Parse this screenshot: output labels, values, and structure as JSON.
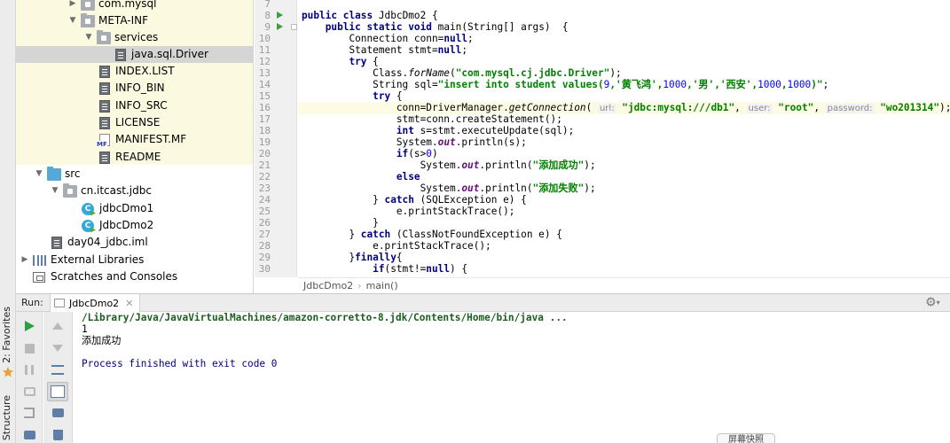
{
  "side_tabs": {
    "favorites": "2: Favorites",
    "structure": "Structure"
  },
  "project_tree": {
    "items": [
      {
        "label": "com.mysql"
      },
      {
        "label": "META-INF"
      },
      {
        "label": "services"
      },
      {
        "label": "java.sql.Driver"
      },
      {
        "label": "INDEX.LIST"
      },
      {
        "label": "INFO_BIN"
      },
      {
        "label": "INFO_SRC"
      },
      {
        "label": "LICENSE"
      },
      {
        "label": "MANIFEST.MF"
      },
      {
        "label": "README"
      },
      {
        "label": "src"
      },
      {
        "label": "cn.itcast.jdbc"
      },
      {
        "label": "jdbcDmo1"
      },
      {
        "label": "JdbcDmo2"
      },
      {
        "label": "day04_jdbc.iml"
      },
      {
        "label": "External Libraries"
      },
      {
        "label": "Scratches and Consoles"
      }
    ]
  },
  "editor": {
    "line_numbers": [
      "7",
      "8",
      "9",
      "10",
      "11",
      "12",
      "13",
      "14",
      "15",
      "16",
      "17",
      "18",
      "19",
      "20",
      "21",
      "22",
      "23",
      "24",
      "25",
      "26",
      "27",
      "28",
      "29",
      "30"
    ],
    "code": {
      "l8_kw1": "public",
      "l8_kw2": "class",
      "l8_rest": " JdbcDmo2 {",
      "l9_kw1": "public",
      "l9_kw2": "static",
      "l9_kw3": "void",
      "l9_rest": " main(String[] args)  {",
      "l10_a": "Connection conn=",
      "l10_kw": "null",
      "l10_b": ";",
      "l11_a": "Statement stmt=",
      "l11_kw": "null",
      "l11_b": ";",
      "l12_kw": "try",
      "l12_b": " {",
      "l13_a": "Class.",
      "l13_m": "forName",
      "l13_b": "(",
      "l13_s": "\"com.mysql.cj.jdbc.Driver\"",
      "l13_c": ");",
      "l14_a": "String sql=",
      "l14_s1": "\"insert into student values(",
      "l14_n1": "9",
      "l14_s2": ",'黄飞鸿',",
      "l14_n2": "1000",
      "l14_s3": ",'男','西安',",
      "l14_n3": "1000",
      "l14_s4": ",",
      "l14_n4": "1000",
      "l14_s5": ")\"",
      "l14_b": ";",
      "l15_kw": "try",
      "l15_b": " {",
      "l16_a": "conn=DriverManager.",
      "l16_m": "getConnection",
      "l16_b": "( ",
      "l16_h1": "url:",
      "l16_s1": "\"jdbc:mysql:///db1\"",
      "l16_c1": ", ",
      "l16_h2": "user:",
      "l16_s2": "\"root\"",
      "l16_c2": ", ",
      "l16_h3": "password:",
      "l16_s3": "\"wo201314\"",
      "l16_end": ");",
      "l17": "stmt=conn.createStatement();",
      "l18_kw": "int",
      "l18_rest": " s=stmt.executeUpdate(sql);",
      "l19_a": "System.",
      "l19_f": "out",
      "l19_b": ".println(s);",
      "l20_kw": "if",
      "l20_a": "(s>",
      "l20_n": "0",
      "l20_b": ")",
      "l21_a": "System.",
      "l21_f": "out",
      "l21_b": ".println(",
      "l21_s": "\"添加成功\"",
      "l21_c": ");",
      "l22_kw": "else",
      "l23_a": "System.",
      "l23_f": "out",
      "l23_b": ".println(",
      "l23_s": "\"添加失败\"",
      "l23_c": ");",
      "l24_a": "} ",
      "l24_kw": "catch",
      "l24_b": " (SQLException e) {",
      "l25": "e.printStackTrace();",
      "l26": "}",
      "l27_a": "} ",
      "l27_kw": "catch",
      "l27_b": " (ClassNotFoundException e) {",
      "l28": "e.printStackTrace();",
      "l29_a": "}",
      "l29_kw": "finally",
      "l29_b": "{",
      "l30_kw": "if",
      "l30_a": "(stmt!=",
      "l30_kw2": "null",
      "l30_b": ") {"
    },
    "breadcrumb": [
      "JdbcDmo2",
      "main()"
    ]
  },
  "run_panel": {
    "label": "Run:",
    "tab_title": "JdbcDmo2",
    "console_lines": {
      "cmd": "/Library/Java/JavaVirtualMachines/amazon-corretto-8.jdk/Contents/Home/bin/java ...",
      "out1": "1",
      "out2": "添加成功",
      "blank": "",
      "exit": "Process finished with exit code 0"
    }
  },
  "overlay": {
    "screenshot_button": "屏幕快照"
  },
  "colors": {
    "keyword": "#000080",
    "string": "#008000",
    "number": "#0000ff",
    "run_green": "#2ea043",
    "tree_highlight": "#fbf9e0"
  }
}
